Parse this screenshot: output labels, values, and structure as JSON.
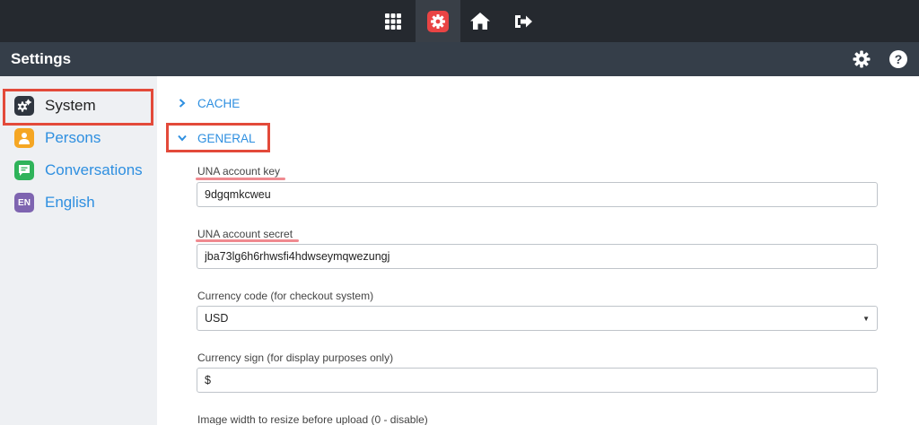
{
  "topnav": {
    "items": [
      {
        "icon": "apps-grid-icon",
        "active": false
      },
      {
        "icon": "settings-gear-icon",
        "active": true
      },
      {
        "icon": "home-icon",
        "active": false
      },
      {
        "icon": "logout-icon",
        "active": false
      }
    ]
  },
  "header": {
    "title": "Settings",
    "icons": [
      "gear-icon",
      "help-icon"
    ]
  },
  "sidebar": {
    "items": [
      {
        "label": "System",
        "icon": "system-cogs-icon",
        "icon_color": "#2f3640",
        "selected": true
      },
      {
        "label": "Persons",
        "icon": "person-icon",
        "icon_color": "#f5a623",
        "selected": false
      },
      {
        "label": "Conversations",
        "icon": "chat-icon",
        "icon_color": "#2fb35a",
        "selected": false
      },
      {
        "label": "English",
        "icon": "language-en-icon",
        "icon_text": "EN",
        "icon_color": "#7e64b0",
        "selected": false
      }
    ]
  },
  "sections": {
    "cache": {
      "label": "CACHE",
      "expanded": false
    },
    "general": {
      "label": "GENERAL",
      "expanded": true
    }
  },
  "fields": {
    "account_key": {
      "label": "UNA account key",
      "value": "9dgqmkcweu"
    },
    "account_secret": {
      "label": "UNA account secret",
      "value": "jba73lg6h6rhwsfi4hdwseymqwezungj"
    },
    "currency_code": {
      "label": "Currency code (for checkout system)",
      "value": "USD"
    },
    "currency_sign": {
      "label": "Currency sign (for display purposes only)",
      "value": "$"
    },
    "image_width": {
      "label": "Image width to resize before upload (0 - disable)"
    }
  },
  "colors": {
    "accent": "#2e8fe0",
    "highlight": "#e34a3a",
    "active_gear": "#e94444"
  }
}
